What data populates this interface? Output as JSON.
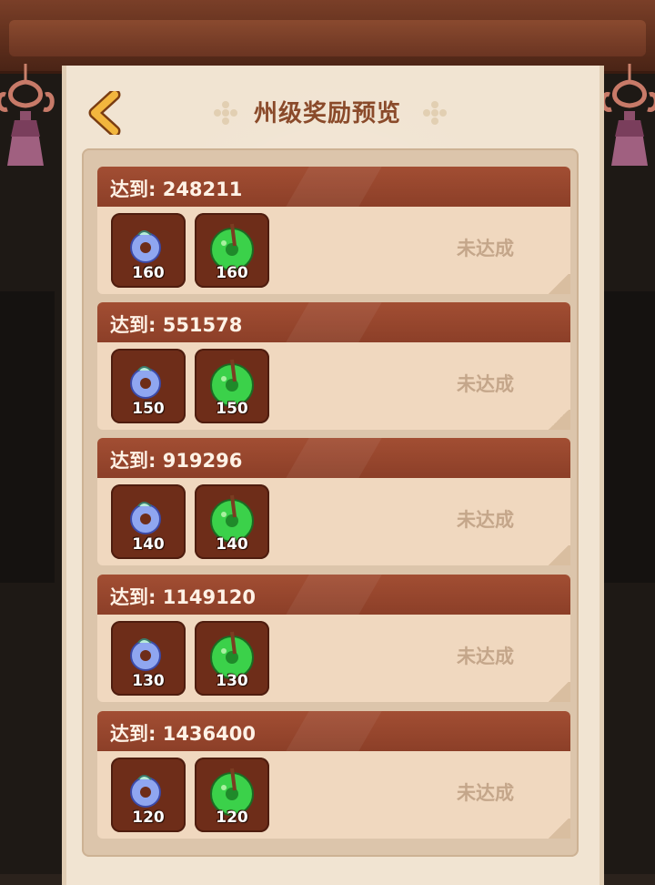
{
  "header": {
    "title": "州级奖励预览"
  },
  "colors": {
    "accent": "#a24e33",
    "gold": "#e8a53a",
    "parchment": "#f1e4d2"
  },
  "rewards": [
    {
      "label": "达到: 248211",
      "items": [
        {
          "icon": "blue-jade-ring-icon",
          "count": "160"
        },
        {
          "icon": "green-jade-ring-icon",
          "count": "160"
        }
      ],
      "status": "未达成"
    },
    {
      "label": "达到: 551578",
      "items": [
        {
          "icon": "blue-jade-ring-icon",
          "count": "150"
        },
        {
          "icon": "green-jade-ring-icon",
          "count": "150"
        }
      ],
      "status": "未达成"
    },
    {
      "label": "达到: 919296",
      "items": [
        {
          "icon": "blue-jade-ring-icon",
          "count": "140"
        },
        {
          "icon": "green-jade-ring-icon",
          "count": "140"
        }
      ],
      "status": "未达成"
    },
    {
      "label": "达到: 1149120",
      "items": [
        {
          "icon": "blue-jade-ring-icon",
          "count": "130"
        },
        {
          "icon": "green-jade-ring-icon",
          "count": "130"
        }
      ],
      "status": "未达成"
    },
    {
      "label": "达到: 1436400",
      "items": [
        {
          "icon": "blue-jade-ring-icon",
          "count": "120"
        },
        {
          "icon": "green-jade-ring-icon",
          "count": "120"
        }
      ],
      "status": "未达成"
    }
  ]
}
